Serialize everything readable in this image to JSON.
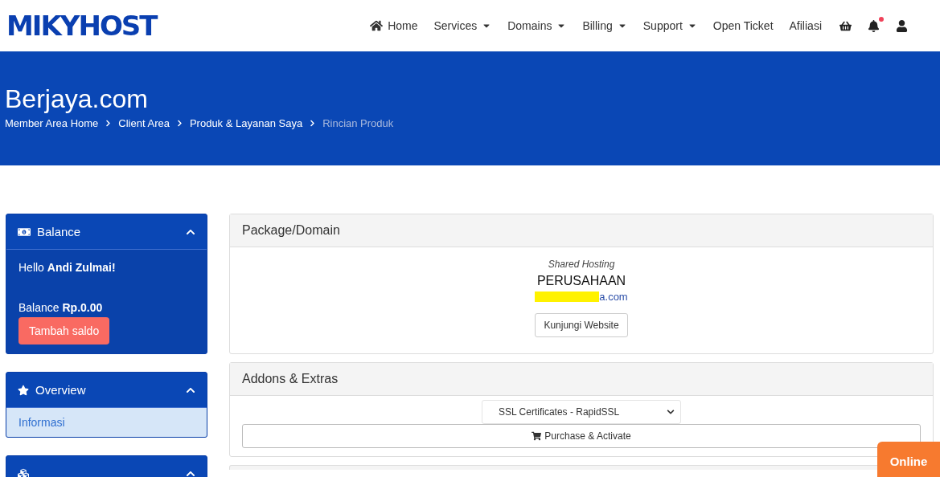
{
  "logo": "MIKYHOST",
  "nav": [
    {
      "label": "Home",
      "kind": "home"
    },
    {
      "label": "Services",
      "kind": "dropdown"
    },
    {
      "label": "Domains",
      "kind": "dropdown"
    },
    {
      "label": "Billing",
      "kind": "dropdown"
    },
    {
      "label": "Support",
      "kind": "dropdown"
    },
    {
      "label": "Open Ticket",
      "kind": "plain"
    },
    {
      "label": "Afiliasi",
      "kind": "plain"
    }
  ],
  "notifications": {
    "unread": true
  },
  "hero": {
    "title": "Berjaya.com",
    "breadcrumb": [
      {
        "label": "Member Area Home",
        "current": false
      },
      {
        "label": "Client Area",
        "current": false
      },
      {
        "label": "Produk & Layanan Saya",
        "current": false
      },
      {
        "label": "Rincian Produk",
        "current": true
      }
    ]
  },
  "sidebar": [
    {
      "kind": "balance",
      "title": "Balance",
      "expanded": true,
      "greeting": "Hello **Andi Zulmai!**",
      "balance": "Balance **Rp.0.00**",
      "button": "Tambah saldo"
    },
    {
      "kind": "menu",
      "title": "Overview",
      "expanded": true,
      "items": [
        {
          "label": "Informasi",
          "selected": true
        }
      ]
    },
    {
      "kind": "menu",
      "expanded": true
    }
  ],
  "package": {
    "title": "Package/Domain",
    "type": "Shared Hosting",
    "name": "PERUSAHAAN",
    "domain_visible": "a.com",
    "domain_redacted": true,
    "button": "Kunjungi Website"
  },
  "addons": {
    "title": "Addons & Extras",
    "select_value": "SSL Certificates - RapidSSL",
    "button": "Purchase & Activate"
  },
  "chat": {
    "label": "Online"
  }
}
